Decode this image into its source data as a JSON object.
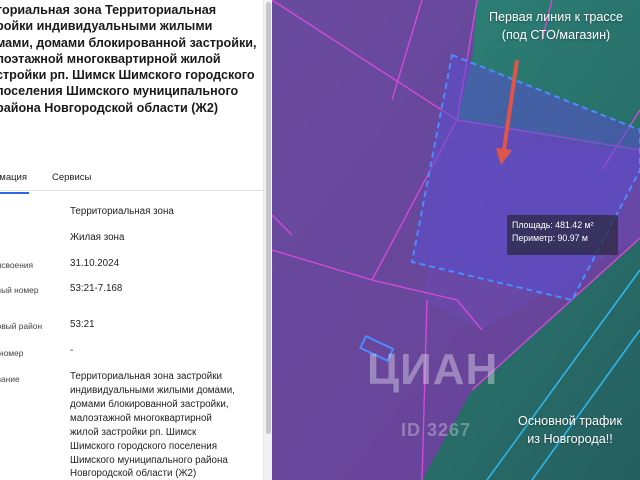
{
  "panel": {
    "title_lines": [
      "ториальная зона Территориальная",
      "ройки индивидуальными жилыми",
      "мами, домами блокированной застройки,",
      "лоэтажной многоквартирной жилой",
      "стройки рп. Шимск Шимского городского",
      "поселения Шимского муниципального",
      "района Новгородской области (Ж2)"
    ],
    "tabs": [
      {
        "label": "рмация",
        "active": true
      },
      {
        "label": "Сервисы",
        "active": false
      }
    ],
    "rows": [
      {
        "label": "",
        "value_lines": [
          "Территориальная зона"
        ]
      },
      {
        "label": "ы",
        "value_lines": [
          "Жилая зона"
        ]
      },
      {
        "label": "рисвоения",
        "value_lines": [
          "31.10.2024"
        ]
      },
      {
        "label_lines": [
          "овый номер",
          "ы"
        ],
        "value_lines": [
          "53:21-7.168"
        ]
      },
      {
        "label": "ровый район",
        "value_lines": [
          "53:21"
        ]
      },
      {
        "label": "й номер",
        "value_lines": [
          "-"
        ]
      },
      {
        "label": "ование",
        "value_lines": [
          "Территориальная зона застройки",
          "индивидуальными жилыми домами,",
          "домами блокированной застройки,",
          "малоэтажной многоквартирной",
          "жилой застройки рп. Шимск",
          "Шимского городского поселения",
          "Шимского муниципального района",
          "Новгородской области (Ж2)"
        ]
      }
    ]
  },
  "map": {
    "callout_top_lines": [
      "Первая линия к трассе",
      "(под СТО/магазин)"
    ],
    "callout_bottom_lines": [
      "Основной трафик",
      "из Новгорода!!"
    ],
    "measure": {
      "area": "Площадь: 481.42 м²",
      "perimeter": "Периметр: 90.97 м"
    },
    "watermark": "ЦИАН",
    "watermark_id": "ID 3267",
    "colors": {
      "zone_purple": "#7a3aa8",
      "zone_border": "#d04ad8",
      "plot_blue": "#5a4fd0",
      "plot_dash": "#4a8cff",
      "road_line": "#2fb5e8",
      "arrow": "#e0554a",
      "green": "#2c7a72"
    }
  }
}
